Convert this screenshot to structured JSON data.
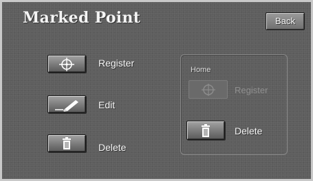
{
  "screen": {
    "title": "Marked Point",
    "back_label": "Back"
  },
  "actions": {
    "register_label": "Register",
    "edit_label": "Edit",
    "delete_label": "Delete"
  },
  "home": {
    "heading": "Home",
    "register_label": "Register",
    "register_enabled": false,
    "delete_label": "Delete"
  },
  "icons": {
    "register": "crosshair-icon",
    "edit": "pen-icon",
    "delete": "trash-icon"
  },
  "colors": {
    "background": "#5e5e5e",
    "button_face": "#8a8a8a",
    "text": "#f4f4f4",
    "disabled_text": "#8f8f8f"
  }
}
